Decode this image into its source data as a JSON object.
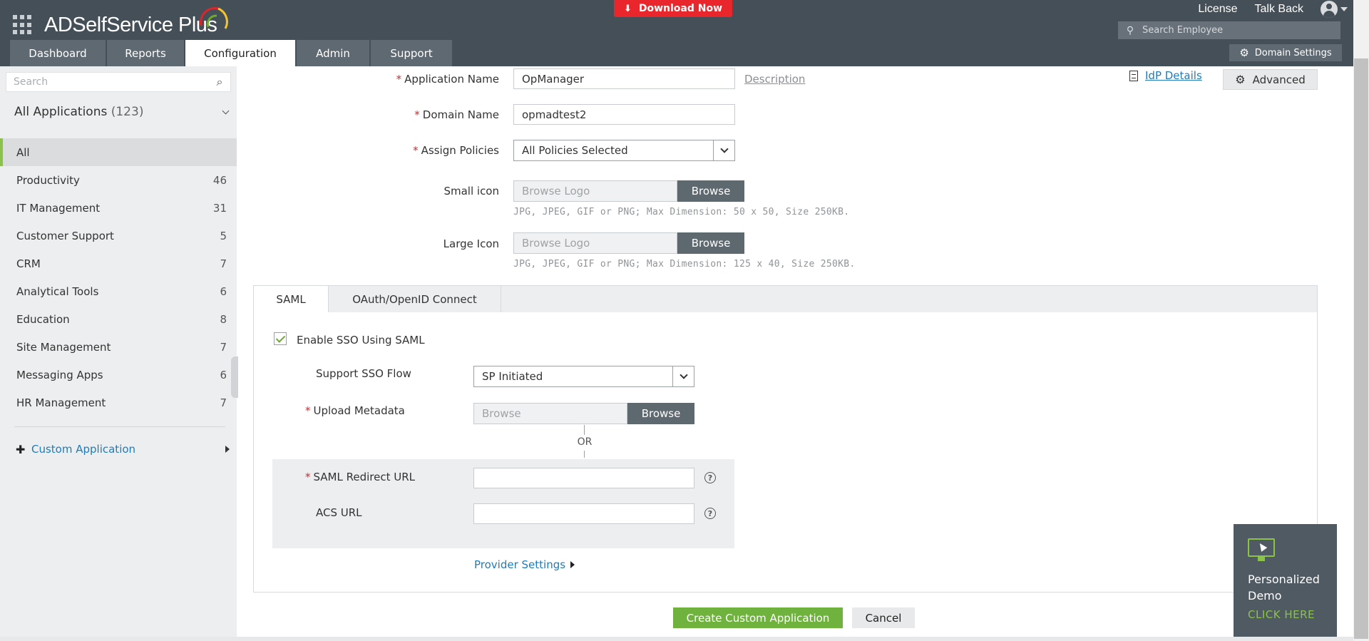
{
  "header": {
    "brand": "ADSelfService Plus",
    "download_label": "Download Now",
    "links": [
      "License",
      "Talk Back"
    ],
    "search_placeholder": "Search Employee",
    "tabs": [
      "Dashboard",
      "Reports",
      "Configuration",
      "Admin",
      "Support"
    ],
    "active_tab": "Configuration",
    "domain_settings_label": "Domain Settings"
  },
  "sidebar": {
    "search_placeholder": "Search",
    "all_apps_label": "All Applications",
    "all_apps_count": "(123)",
    "categories": [
      {
        "label": "All",
        "count": ""
      },
      {
        "label": "Productivity",
        "count": "46"
      },
      {
        "label": "IT Management",
        "count": "31"
      },
      {
        "label": "Customer Support",
        "count": "5"
      },
      {
        "label": "CRM",
        "count": "7"
      },
      {
        "label": "Analytical Tools",
        "count": "6"
      },
      {
        "label": "Education",
        "count": "8"
      },
      {
        "label": "Site Management",
        "count": "7"
      },
      {
        "label": "Messaging Apps",
        "count": "6"
      },
      {
        "label": "HR Management",
        "count": "7"
      }
    ],
    "custom_app_label": "Custom Application"
  },
  "form": {
    "app_name_label": "Application Name",
    "app_name_value": "OpManager",
    "description_link": "Description",
    "domain_name_label": "Domain Name",
    "domain_name_value": "opmadtest2",
    "assign_policies_label": "Assign Policies",
    "assign_policies_value": "All Policies Selected",
    "small_icon_label": "Small icon",
    "large_icon_label": "Large Icon",
    "browse_logo_placeholder": "Browse Logo",
    "browse_label": "Browse",
    "small_icon_hint": "JPG, JPEG, GIF or PNG; Max Dimension: 50 x 50, Size 250KB.",
    "large_icon_hint": "JPG, JPEG, GIF or PNG; Max Dimension: 125 x 40, Size 250KB.",
    "idp_details_link": "IdP Details",
    "advanced_label": "Advanced"
  },
  "saml": {
    "tabs": [
      "SAML",
      "OAuth/OpenID Connect"
    ],
    "active_tab": "SAML",
    "enable_sso_label": "Enable SSO Using SAML",
    "enable_sso_checked": true,
    "support_flow_label": "Support SSO Flow",
    "support_flow_value": "SP Initiated",
    "upload_metadata_label": "Upload Metadata",
    "browse_placeholder": "Browse",
    "browse_label": "Browse",
    "or_label": "OR",
    "redirect_url_label": "SAML Redirect URL",
    "redirect_url_value": "",
    "acs_url_label": "ACS URL",
    "acs_url_value": "",
    "help_glyph": "?",
    "provider_settings_label": "Provider Settings"
  },
  "actions": {
    "create_label": "Create Custom Application",
    "cancel_label": "Cancel"
  },
  "demo_widget": {
    "title": "Personalized Demo",
    "cta": "CLICK HERE"
  },
  "colors": {
    "header_bg": "#454f57",
    "download_red": "#e8262b",
    "accent_green": "#6fb33e",
    "link_blue": "#1f7cb8",
    "required_red": "#d9262c"
  }
}
